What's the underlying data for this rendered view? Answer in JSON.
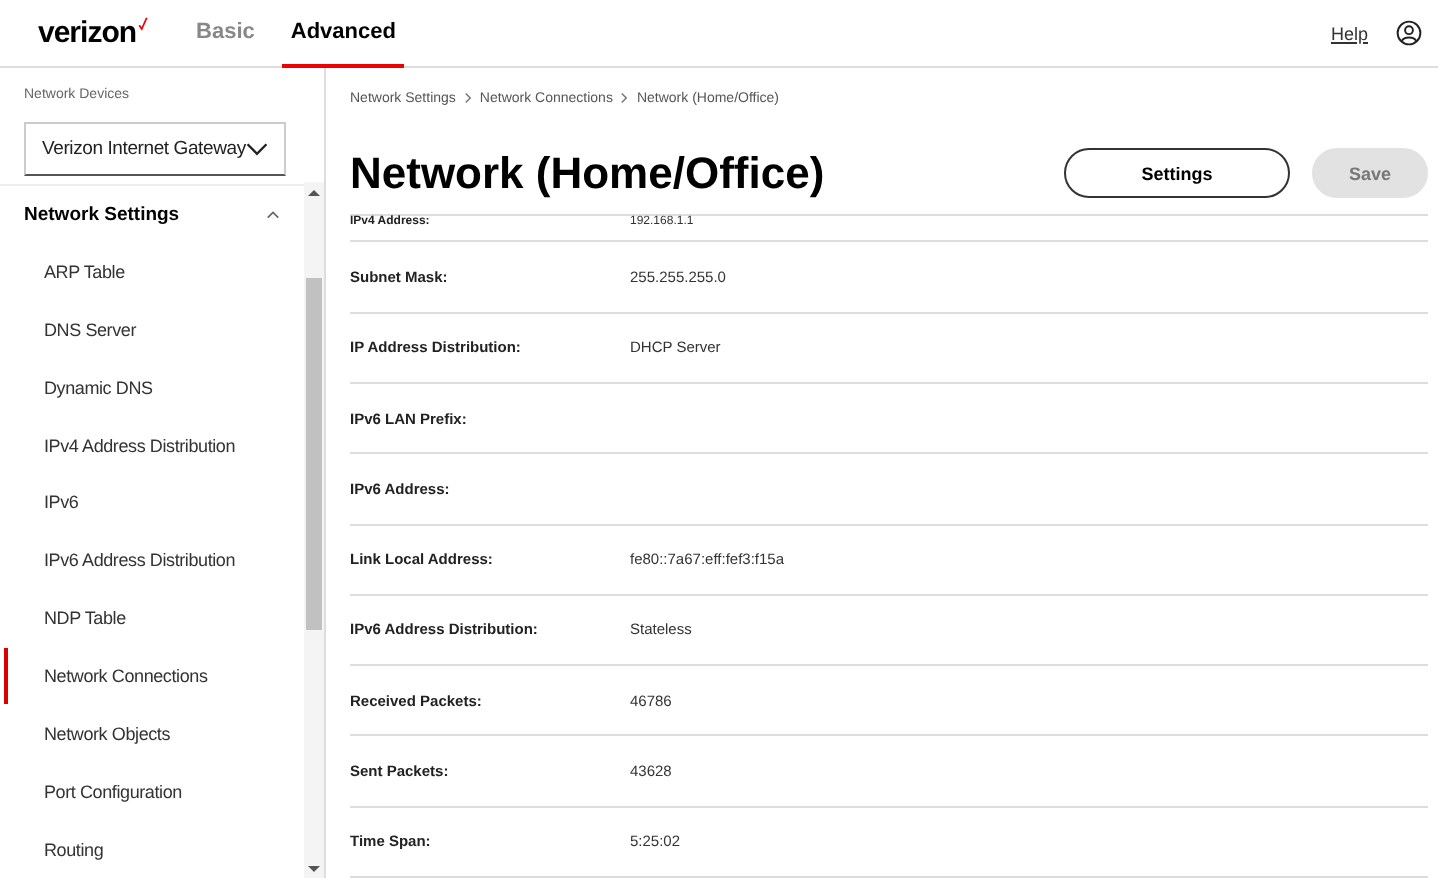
{
  "header": {
    "logo": "verizon",
    "tabs": [
      {
        "label": "Basic",
        "selected": false
      },
      {
        "label": "Advanced",
        "selected": true
      }
    ],
    "help": "Help"
  },
  "sidebar": {
    "devices_label": "Network Devices",
    "device": "Verizon Internet Gateway",
    "group": {
      "label": "Network Settings",
      "expanded": true,
      "items": [
        {
          "label": "ARP Table",
          "selected": false
        },
        {
          "label": "DNS Server",
          "selected": false
        },
        {
          "label": "Dynamic DNS",
          "selected": false
        },
        {
          "label": "IPv4 Address Distribution",
          "selected": false
        },
        {
          "label": "IPv6",
          "selected": false
        },
        {
          "label": "IPv6 Address Distribution",
          "selected": false
        },
        {
          "label": "NDP Table",
          "selected": false
        },
        {
          "label": "Network Connections",
          "selected": true
        },
        {
          "label": "Network Objects",
          "selected": false
        },
        {
          "label": "Port Configuration",
          "selected": false
        },
        {
          "label": "Routing",
          "selected": false
        }
      ]
    }
  },
  "breadcrumb": [
    "Network Settings",
    "Network Connections",
    "Network (Home/Office)"
  ],
  "title": "Network (Home/Office)",
  "buttons": [
    {
      "label": "Settings",
      "disabled": false
    },
    {
      "label": "Save",
      "disabled": true
    }
  ],
  "rows": [
    {
      "label": "IPv4 Address:",
      "value": "192.168.1.1"
    },
    {
      "label": "Subnet Mask:",
      "value": "255.255.255.0"
    },
    {
      "label": "IP Address Distribution:",
      "value": "DHCP Server"
    },
    {
      "label": "IPv6 LAN Prefix:",
      "value": ""
    },
    {
      "label": "IPv6 Address:",
      "value": ""
    },
    {
      "label": "Link Local Address:",
      "value": "fe80::7a67:eff:fef3:f15a"
    },
    {
      "label": "IPv6 Address Distribution:",
      "value": "Stateless"
    },
    {
      "label": "Received Packets:",
      "value": "46786"
    },
    {
      "label": "Sent Packets:",
      "value": "43628"
    },
    {
      "label": "Time Span:",
      "value": "5:25:02"
    }
  ]
}
